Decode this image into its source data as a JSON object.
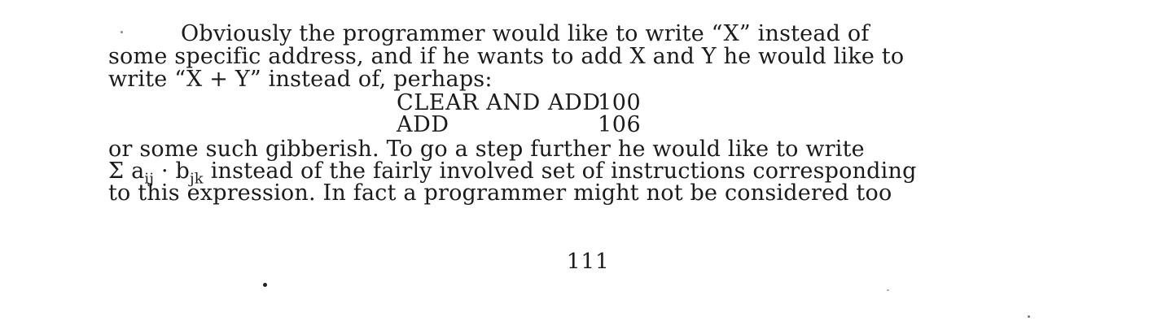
{
  "paragraph": {
    "line1": "Obviously the programmer would like to write “X” instead of",
    "line2": "some specific address, and if he wants to add X and Y he would like to",
    "line3": "write “X + Y” instead of, perhaps:",
    "line4": "or some such gibberish. To go a step further he would like to write",
    "line5_rest": "instead of the fairly involved set of instructions corresponding",
    "line6": "to this expression. In fact a programmer might not be considered too"
  },
  "code_block": [
    {
      "op": "CLEAR AND ADD",
      "operand": "100"
    },
    {
      "op": "ADD",
      "operand": "106"
    }
  ],
  "formula": {
    "sigma": "Σ",
    "a": "a",
    "a_sub": "ij",
    "dot": "·",
    "b": "b",
    "b_sub": "jk"
  },
  "page_number": "111"
}
